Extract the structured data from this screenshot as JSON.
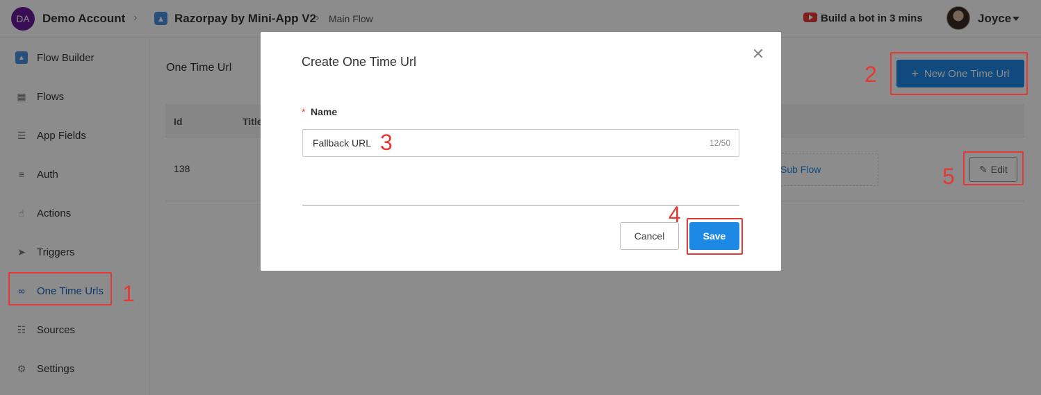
{
  "header": {
    "account_initials": "DA",
    "account_name": "Demo Account",
    "app_name": "Razorpay by Mini-App V2",
    "flow_name": "Main Flow",
    "build_bot_label": "Build a bot in 3 mins",
    "user_name": "Joyce"
  },
  "sidebar": {
    "items": [
      {
        "label": "Flow Builder",
        "icon": "flow-builder-icon"
      },
      {
        "label": "Flows",
        "icon": "grid-icon"
      },
      {
        "label": "App Fields",
        "icon": "fields-icon"
      },
      {
        "label": "Auth",
        "icon": "auth-icon"
      },
      {
        "label": "Actions",
        "icon": "hand-pointer-icon"
      },
      {
        "label": "Triggers",
        "icon": "send-icon"
      },
      {
        "label": "One Time Urls",
        "icon": "link-icon",
        "active": true
      },
      {
        "label": "Sources",
        "icon": "document-icon"
      },
      {
        "label": "Settings",
        "icon": "gear-icon"
      }
    ]
  },
  "main": {
    "page_title": "One Time Url",
    "new_button_label": "New One Time Url",
    "table": {
      "headers": [
        "Id",
        "Title"
      ],
      "rows": [
        {
          "id": "138",
          "subflow_label": "Sub Flow",
          "edit_label": "Edit"
        }
      ]
    }
  },
  "modal": {
    "title": "Create One Time Url",
    "field_required_mark": "*",
    "field_label": "Name",
    "field_value": "Fallback URL",
    "char_count": "12/50",
    "cancel_label": "Cancel",
    "save_label": "Save"
  },
  "annotations": {
    "step1": "1",
    "step2": "2",
    "step3": "3",
    "step4": "4",
    "step5": "5",
    "color": "#e53935"
  },
  "colors": {
    "primary": "#1e88e5",
    "active_nav": "#1565c0",
    "account_avatar": "#6a1b9a"
  }
}
